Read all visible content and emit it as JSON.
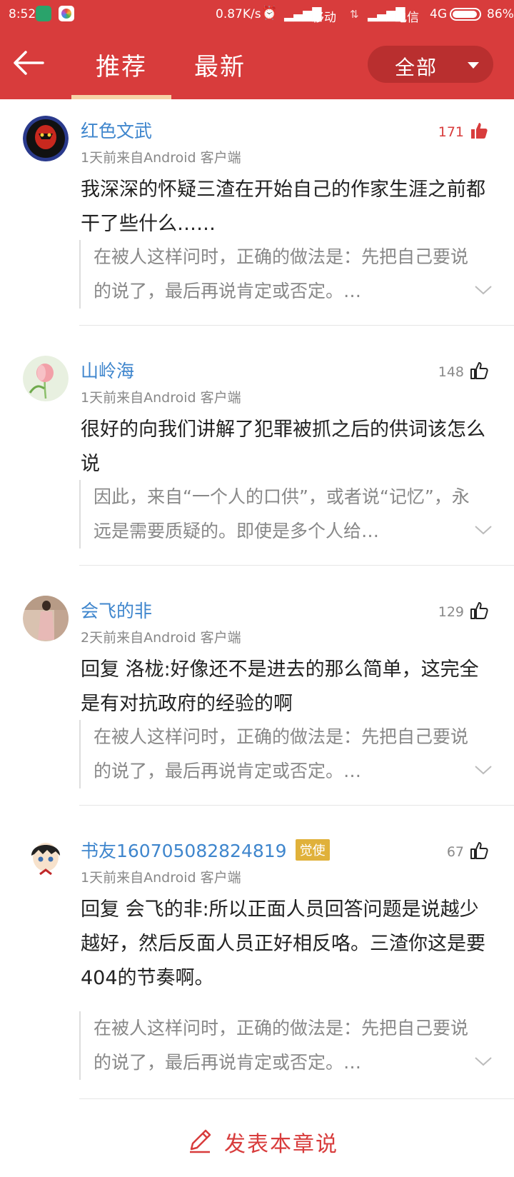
{
  "status_bar": {
    "time": "8:52",
    "speed": "0.87K/s",
    "operator1": "移动",
    "operator2": "电信",
    "network": "4G",
    "battery": "86%"
  },
  "header": {
    "back_icon": "back-arrow-icon",
    "tabs": [
      {
        "label": "推荐",
        "active": true
      },
      {
        "label": "最新",
        "active": false
      }
    ],
    "filter_label": "全部",
    "accent_color": "#d83c3c"
  },
  "comments": [
    {
      "username": "红色文武",
      "meta": "1天前来自Android 客户端",
      "likes": "171",
      "liked": true,
      "text": "我深深的怀疑三渣在开始自己的作家生涯之前都干了些什么……",
      "quote": "在被人这样问时，正确的做法是：先把自己要说的说了，最后再说肯定或否定。…"
    },
    {
      "username": "山岭海",
      "meta": "1天前来自Android 客户端",
      "likes": "148",
      "liked": false,
      "text": "很好的向我们讲解了犯罪被抓之后的供词该怎么说",
      "quote": "因此，来自“一个人的口供”，或者说“记忆”，永远是需要质疑的。即使是多个人给…"
    },
    {
      "username": "会飞的非",
      "meta": "2天前来自Android 客户端",
      "likes": "129",
      "liked": false,
      "text": "回复 洛栊:好像还不是进去的那么简单，这完全是有对抗政府的经验的啊",
      "quote": "在被人这样问时，正确的做法是：先把自己要说的说了，最后再说肯定或否定。…"
    },
    {
      "username": "书友160705082824819",
      "badge": "觉使",
      "meta": "1天前来自Android 客户端",
      "likes": "67",
      "liked": false,
      "text": "回复 会飞的非:所以正面人员回答问题是说越少越好，然后反面人员正好相反咯。三渣你这是要404的节奏啊。",
      "quote": "在被人这样问时，正确的做法是：先把自己要说的说了，最后再说肯定或否定。…"
    }
  ],
  "post_bar": {
    "label": "发表本章说",
    "icon": "pen-icon"
  }
}
